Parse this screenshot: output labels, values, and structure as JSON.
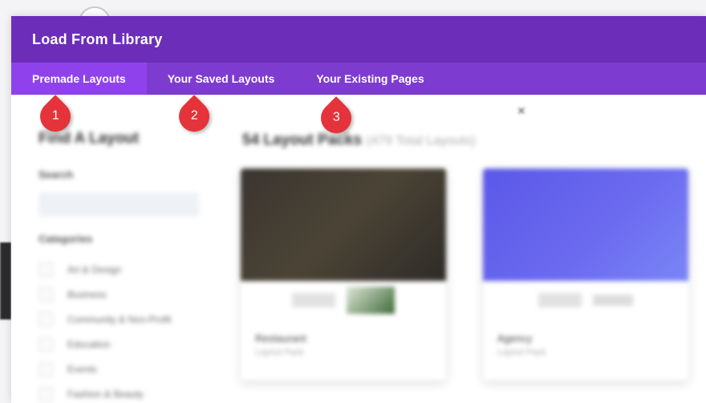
{
  "modal": {
    "title": "Load From Library",
    "tabs": [
      {
        "label": "Premade Layouts",
        "active": true
      },
      {
        "label": "Your Saved Layouts",
        "active": false
      },
      {
        "label": "Your Existing Pages",
        "active": false
      }
    ]
  },
  "annotations": [
    "1",
    "2",
    "3"
  ],
  "colors": {
    "header": "#6c2eb9",
    "tabbar": "#7e3bd0",
    "active_tab": "#8f42ec",
    "pin": "#e4333a"
  },
  "sidebar": {
    "heading": "Find A Layout",
    "search_label": "Search",
    "categories_label": "Categories",
    "categories": [
      "Art & Design",
      "Business",
      "Community & Non-Profit",
      "Education",
      "Events",
      "Fashion & Beauty"
    ]
  },
  "main": {
    "heading": "54 Layout Packs",
    "subheading": "(479 Total Layouts)",
    "cards": [
      {
        "name": "Restaurant",
        "type": "Layout Pack"
      },
      {
        "name": "Agency",
        "type": "Layout Pack"
      }
    ]
  }
}
